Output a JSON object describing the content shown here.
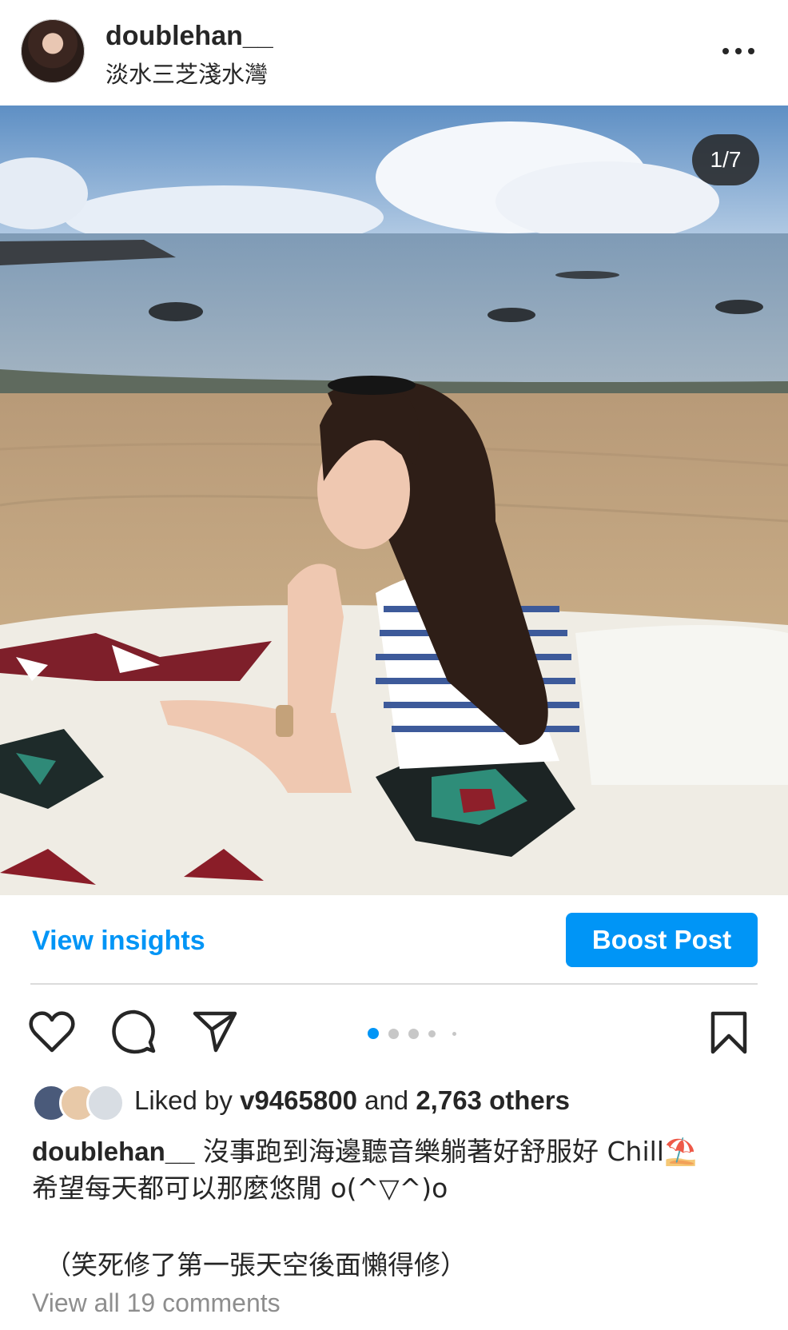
{
  "post": {
    "username": "doublehan__",
    "location": "淡水三芝淺水灣",
    "photo_counter": "1/7",
    "more_icon": "more-horizontal-icon"
  },
  "actions": {
    "view_insights": "View insights",
    "boost_post": "Boost Post",
    "icons": [
      "heart-icon",
      "comment-icon",
      "share-icon",
      "bookmark-icon"
    ],
    "carousel": {
      "total_dots": 5,
      "active_index": 0
    }
  },
  "likes": {
    "prefix": "Liked by ",
    "user": "v9465800",
    "middle": " and ",
    "others": "2,763 others"
  },
  "caption": {
    "user": "doublehan__",
    "line1": " 沒事跑到海邊聽音樂躺著好舒服好 Chill⛱️",
    "line2": "希望每天都可以那麼悠閒 o(^▽^)o",
    "note": "（笑死修了第一張天空後面懶得修）",
    "view_comments": "View all 19 comments"
  },
  "colors": {
    "accent": "#0095f6",
    "text": "#262626",
    "muted": "#8e8e8e",
    "divider": "#dbdbdb"
  }
}
